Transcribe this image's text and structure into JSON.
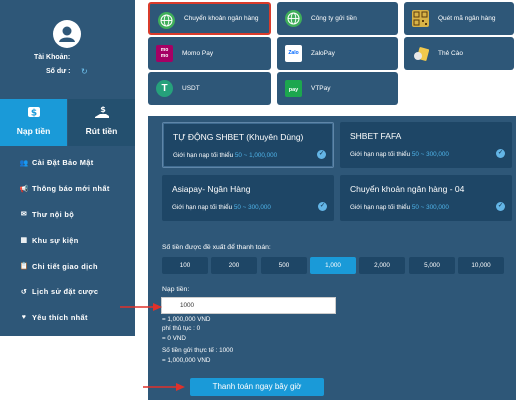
{
  "sidebar": {
    "account_label": "Tài Khoản:",
    "balance_label": "Số dư :",
    "tabs": [
      {
        "label": "Nạp tiền",
        "icon": "deposit-money-icon"
      },
      {
        "label": "Rút tiền",
        "icon": "withdraw-money-icon"
      }
    ],
    "menu": [
      {
        "label": "Cài Đặt Bảo Mật",
        "icon": "users-cog-icon"
      },
      {
        "label": "Thông báo mới nhất",
        "icon": "bullhorn-icon"
      },
      {
        "label": "Thư nội bộ",
        "icon": "envelope-icon"
      },
      {
        "label": "Khu sự kiện",
        "icon": "calendar-icon"
      },
      {
        "label": "Chi tiết giao dịch",
        "icon": "clipboard-icon"
      },
      {
        "label": "Lịch sử đặt cược",
        "icon": "history-icon"
      },
      {
        "label": "Yêu thích nhất",
        "icon": "heart-icon"
      }
    ]
  },
  "payment_methods": [
    {
      "label": "Chuyển khoản ngân hàng",
      "icon": "globe-icon",
      "selected": true
    },
    {
      "label": "Công ty gửi tiền",
      "icon": "globe-icon"
    },
    {
      "label": "Quét mã ngân hàng",
      "icon": "qr-code-icon"
    },
    {
      "label": "Momo Pay",
      "icon": "momo-logo-icon",
      "logo_text": "mo\nmo"
    },
    {
      "label": "ZaloPay",
      "icon": "zalopay-logo-icon",
      "logo_text": "Zalo"
    },
    {
      "label": "Thẻ Cào",
      "icon": "scratch-card-icon"
    },
    {
      "label": "USDT",
      "icon": "tether-logo-icon",
      "logo_text": "T"
    },
    {
      "label": "VTPay",
      "icon": "vtpay-logo-icon",
      "logo_text": "pay"
    }
  ],
  "channels": [
    {
      "title": "TỰ ĐỘNG SHBET (Khuyên Dùng)",
      "limit_prefix": "Giới hạn nạp tối thiểu",
      "range": "50 ~ 1,000,000",
      "active": true
    },
    {
      "title": "SHBET FAFA",
      "limit_prefix": "Giới hạn nạp tối thiểu",
      "range": "50 ~ 300,000"
    },
    {
      "title": "Asiapay- Ngân Hàng",
      "limit_prefix": "Giới hạn nạp tối thiểu",
      "range": "50 ~ 300,000"
    },
    {
      "title": "Chuyển khoản ngân hàng - 04",
      "limit_prefix": "Giới hạn nạp tối thiểu",
      "range": "50 ~ 300,000"
    }
  ],
  "suggested": {
    "label": "Số tiền được đề xuất để thanh toán:",
    "amounts": [
      "100",
      "200",
      "500",
      "1,000",
      "2,000",
      "5,000",
      "10,000"
    ],
    "active_index": 3
  },
  "deposit": {
    "label": "Nạp tiền:",
    "value": "1000",
    "equals_vnd": "= 1,000,000 VND",
    "fee_label": "phí thủ tục :  0",
    "fee_vnd": "= 0 VND",
    "actual_label": "Số tiền gửi thực tế :   1000",
    "actual_vnd": "= 1,000,000 VND",
    "submit_label": "Thanh toán ngay bây giờ"
  },
  "colors": {
    "panel": "#2e5778",
    "card": "#1e4666",
    "accent": "#1a9ad8",
    "highlight_border": "#d93b2b",
    "annotation_arrow": "#e0312a"
  }
}
